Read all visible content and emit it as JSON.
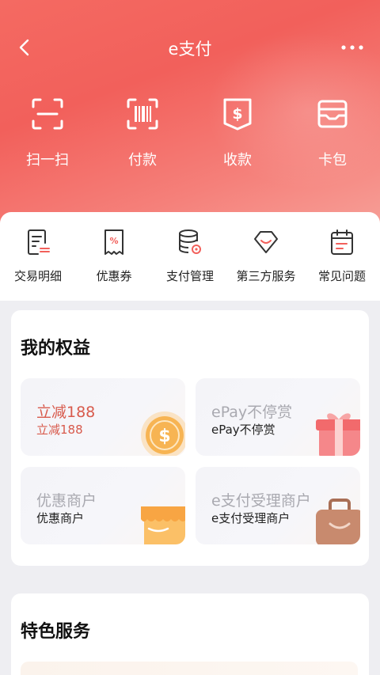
{
  "header": {
    "title": "e支付"
  },
  "top_actions": [
    {
      "label": "扫一扫",
      "icon": "scan-icon"
    },
    {
      "label": "付款",
      "icon": "barcode-icon"
    },
    {
      "label": "收款",
      "icon": "collect-icon"
    },
    {
      "label": "卡包",
      "icon": "wallet-icon"
    }
  ],
  "quick_menu": [
    {
      "label": "交易明细",
      "icon": "transaction-detail-icon"
    },
    {
      "label": "优惠券",
      "icon": "coupon-icon"
    },
    {
      "label": "支付管理",
      "icon": "payment-settings-icon"
    },
    {
      "label": "第三方服务",
      "icon": "third-party-icon"
    },
    {
      "label": "常见问题",
      "icon": "faq-icon"
    }
  ],
  "rights": {
    "title": "我的权益",
    "tiles": [
      {
        "title": "立减188",
        "subtitle": "立减188",
        "icon": "coin-icon"
      },
      {
        "title": "ePay不停赏",
        "subtitle": "ePay不停赏",
        "icon": "gift-icon"
      },
      {
        "title": "优惠商户",
        "subtitle": "优惠商户",
        "icon": "store-icon"
      },
      {
        "title": "e支付受理商户",
        "subtitle": "e支付受理商户",
        "icon": "briefcase-icon"
      }
    ]
  },
  "features": {
    "title": "特色服务"
  },
  "colors": {
    "brand": "#f2605b",
    "accent_text": "#d85a4c"
  }
}
